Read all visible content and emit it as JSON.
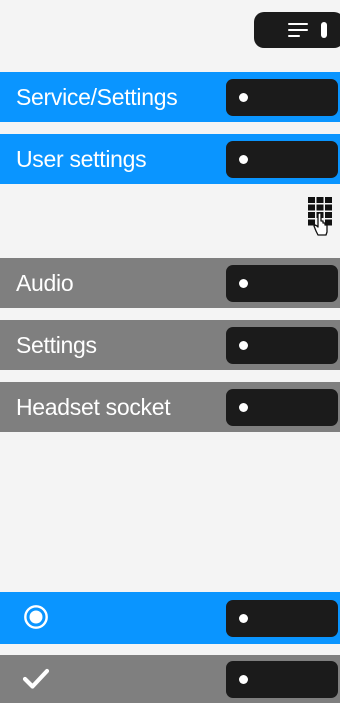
{
  "menu_key": {
    "icon": "menu-icon"
  },
  "items": [
    {
      "label": "Service/Settings",
      "style": "blue",
      "softkey_icon": "dot-icon"
    },
    {
      "label": "User settings",
      "style": "blue",
      "softkey_icon": "dot-icon"
    },
    {
      "label": "Audio",
      "style": "gray",
      "softkey_icon": "dot-icon"
    },
    {
      "label": "Settings",
      "style": "gray",
      "softkey_icon": "dot-icon"
    },
    {
      "label": "Headset socket",
      "style": "gray",
      "softkey_icon": "dot-icon"
    }
  ],
  "keypad_hint": {
    "icon": "keypad-touch-icon"
  },
  "option_rows": [
    {
      "icon": "radio-selected-icon",
      "style": "blue"
    },
    {
      "icon": "checkmark-icon",
      "style": "gray"
    }
  ],
  "colors": {
    "background": "#f4f4f4",
    "blue_row": "#0a95ff",
    "gray_row": "#7f7f7f",
    "softkey": "#1b1b1b",
    "text": "#ffffff"
  }
}
